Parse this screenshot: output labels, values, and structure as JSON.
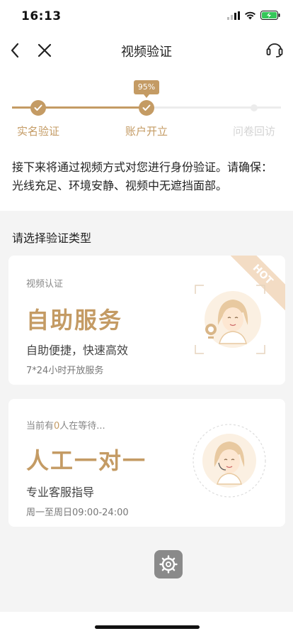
{
  "status_bar": {
    "time": "16:13"
  },
  "nav": {
    "title": "视频验证"
  },
  "progress": {
    "badge": "95%",
    "percent": 95,
    "steps": [
      {
        "label": "实名验证",
        "state": "done"
      },
      {
        "label": "账户开立",
        "state": "done"
      },
      {
        "label": "问卷回访",
        "state": "pending"
      }
    ]
  },
  "intro": "接下来将通过视频方式对您进行身份验证。请确保：光线充足、环境安静、视频中无遮挡面部。",
  "section_title": "请选择验证类型",
  "cards": [
    {
      "subtitle": "视频认证",
      "title": "自助服务",
      "desc": "自助便捷，快速高效",
      "hours": "7*24小时开放服务",
      "badge": "HOT"
    },
    {
      "subtitle_prefix": "当前有",
      "queue_count": "0",
      "subtitle_suffix": "人在等待...",
      "title": "人工一对一",
      "desc": "专业客服指导",
      "hours": "周一至周日09:00-24:00"
    }
  ],
  "colors": {
    "accent": "#c49b64",
    "accent_light": "#f3dcc4",
    "background": "#f4f4f4"
  },
  "icons": [
    "back-icon",
    "close-icon",
    "customer-service-icon",
    "settings-icon"
  ]
}
